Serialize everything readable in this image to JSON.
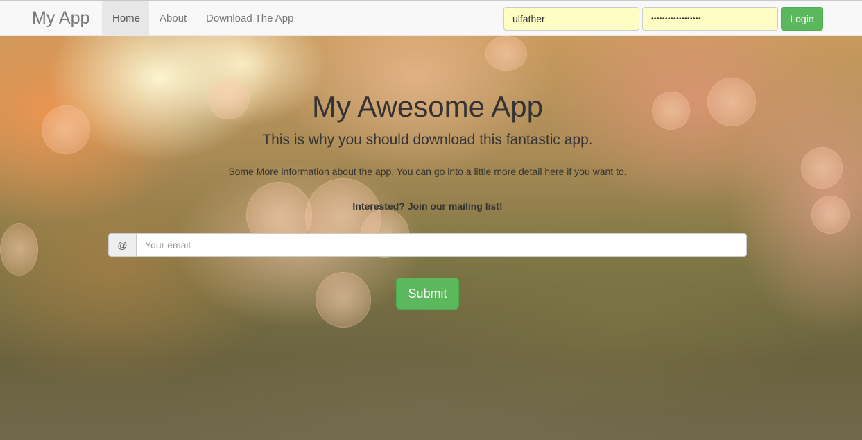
{
  "navbar": {
    "brand": "My App",
    "links": [
      {
        "label": "Home",
        "active": true
      },
      {
        "label": "About",
        "active": false
      },
      {
        "label": "Download The App",
        "active": false
      }
    ],
    "username_value": "ulfather",
    "password_value": "••••••••••••••••••",
    "login_label": "Login"
  },
  "hero": {
    "title": "My Awesome App",
    "subtitle": "This is why you should download this fantastic app.",
    "info": "Some More information about the app. You can go into a little more detail here if you want to.",
    "cta": "Interested? Join our mailing list!",
    "email_addon": "@",
    "email_placeholder": "Your email",
    "submit_label": "Submit"
  },
  "colors": {
    "success": "#5cb85c",
    "navbar_bg": "#f8f8f8",
    "autofill_bg": "#fefdc3"
  }
}
